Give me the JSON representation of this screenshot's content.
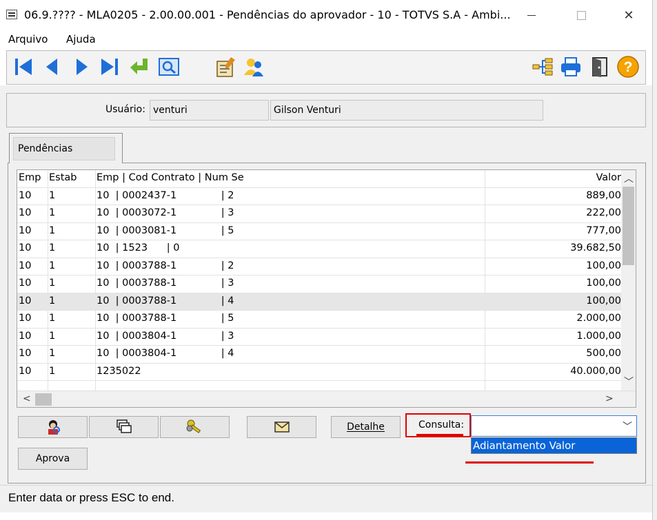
{
  "window": {
    "title": "06.9.???? - MLA0205 - 2.00.00.001 - Pendências do aprovador - 10 - TOTVS S.A - Ambi...",
    "close_glyph": "✕"
  },
  "menu": {
    "items": [
      "Arquivo",
      "Ajuda"
    ]
  },
  "toolbar": {
    "icons": [
      "first-record-icon",
      "previous-record-icon",
      "next-record-icon",
      "last-record-icon",
      "return-icon",
      "search-zoom-icon",
      "edit-document-icon",
      "users-icon",
      "tree-structure-icon",
      "print-icon",
      "exit-door-icon",
      "help-icon"
    ],
    "help_glyph": "?"
  },
  "user": {
    "label": "Usuário:",
    "login": "venturi",
    "name": "Gilson Venturi"
  },
  "tabs": [
    {
      "label": "Pendências"
    }
  ],
  "grid": {
    "headers": [
      "Emp",
      "Estab",
      "Emp | Cod Contrato | Num Se",
      "Valor"
    ],
    "rows": [
      {
        "emp": "10",
        "estab": "1",
        "ref": "10  | 0002437-1              | 2",
        "valor": "889,00"
      },
      {
        "emp": "10",
        "estab": "1",
        "ref": "10  | 0003072-1              | 3",
        "valor": "222,00"
      },
      {
        "emp": "10",
        "estab": "1",
        "ref": "10  | 0003081-1              | 5",
        "valor": "777,00"
      },
      {
        "emp": "10",
        "estab": "1",
        "ref": "10  | 1523      | 0",
        "valor": "39.682,50"
      },
      {
        "emp": "10",
        "estab": "1",
        "ref": "10  | 0003788-1              | 2",
        "valor": "100,00"
      },
      {
        "emp": "10",
        "estab": "1",
        "ref": "10  | 0003788-1              | 3",
        "valor": "100,00"
      },
      {
        "emp": "10",
        "estab": "1",
        "ref": "10  | 0003788-1              | 4",
        "valor": "100,00"
      },
      {
        "emp": "10",
        "estab": "1",
        "ref": "10  | 0003788-1              | 5",
        "valor": "2.000,00"
      },
      {
        "emp": "10",
        "estab": "1",
        "ref": "10  | 0003804-1              | 3",
        "valor": "1.000,00"
      },
      {
        "emp": "10",
        "estab": "1",
        "ref": "10  | 0003804-1              | 4",
        "valor": "500,00"
      },
      {
        "emp": "10",
        "estab": "1",
        "ref": "1235022",
        "valor": "40.000,00"
      }
    ],
    "selected_row": 6,
    "scroll_glyphs": {
      "up": "︿",
      "down": "﹀",
      "left": "<",
      "right": ">"
    }
  },
  "actions": {
    "detalhe": "Detalhe",
    "aprova": "Aprova",
    "consulta_label": "Consulta:",
    "consulta_value": "",
    "consulta_options": [
      "Adiantamento Valor"
    ],
    "combo_glyph": "﹀"
  },
  "status": {
    "text": "Enter data or press ESC to end."
  },
  "colors": {
    "accent": "#0a64d8",
    "highlight": "#e00000",
    "icon_blue": "#1e6fd9",
    "icon_green": "#6cb52d",
    "help_orange": "#f4a300"
  }
}
